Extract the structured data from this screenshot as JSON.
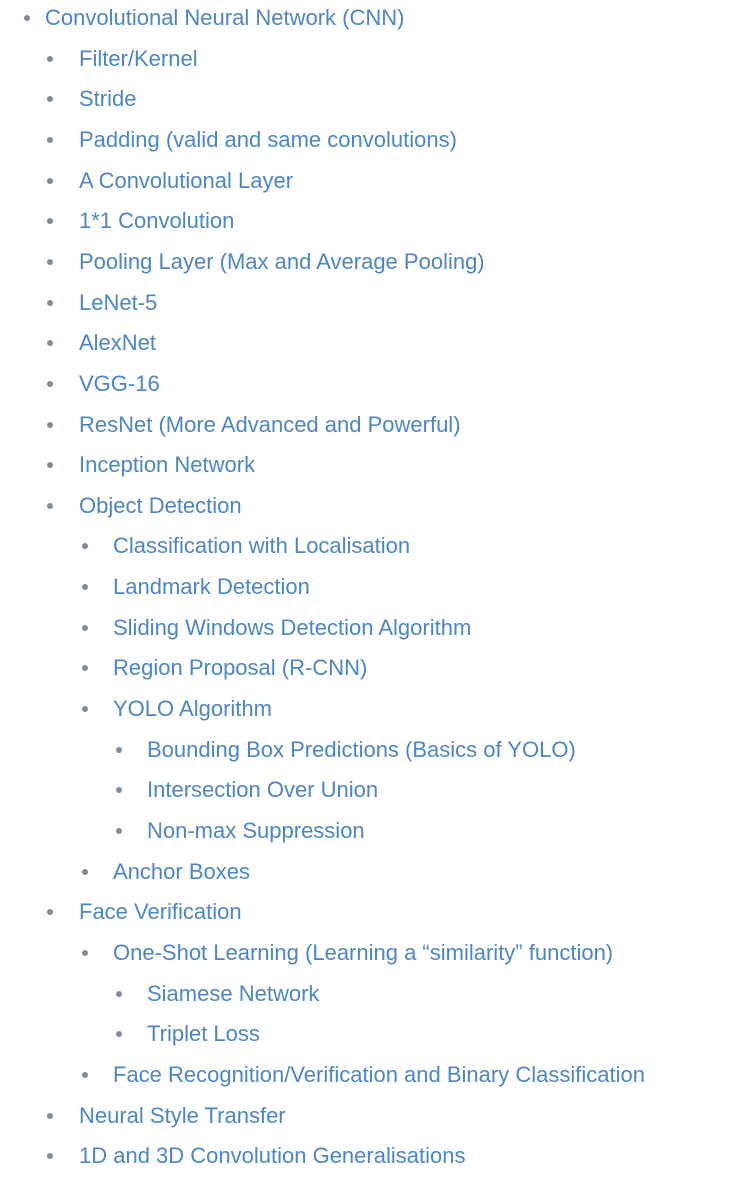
{
  "outline": [
    {
      "level": 0,
      "text": "Convolutional Neural Network (CNN)"
    },
    {
      "level": 1,
      "text": "Filter/Kernel"
    },
    {
      "level": 1,
      "text": "Stride"
    },
    {
      "level": 1,
      "text": "Padding (valid and same convolutions)"
    },
    {
      "level": 1,
      "text": "A Convolutional Layer"
    },
    {
      "level": 1,
      "text": "1*1 Convolution"
    },
    {
      "level": 1,
      "text": "Pooling Layer (Max and Average Pooling)"
    },
    {
      "level": 1,
      "text": "LeNet-5"
    },
    {
      "level": 1,
      "text": "AlexNet"
    },
    {
      "level": 1,
      "text": "VGG-16"
    },
    {
      "level": 1,
      "text": "ResNet (More Advanced and Powerful)"
    },
    {
      "level": 1,
      "text": "Inception Network"
    },
    {
      "level": 1,
      "text": "Object Detection"
    },
    {
      "level": 2,
      "text": "Classification with Localisation"
    },
    {
      "level": 2,
      "text": "Landmark Detection"
    },
    {
      "level": 2,
      "text": "Sliding Windows Detection Algorithm"
    },
    {
      "level": 2,
      "text": "Region Proposal (R-CNN)"
    },
    {
      "level": 2,
      "text": "YOLO Algorithm"
    },
    {
      "level": 3,
      "text": "Bounding Box Predictions (Basics of YOLO)"
    },
    {
      "level": 3,
      "text": "Intersection Over Union"
    },
    {
      "level": 3,
      "text": "Non-max Suppression"
    },
    {
      "level": 2,
      "text": "Anchor Boxes"
    },
    {
      "level": 1,
      "text": "Face Verification"
    },
    {
      "level": 2,
      "text": "One-Shot Learning (Learning a “similarity” function)"
    },
    {
      "level": 3,
      "text": "Siamese Network"
    },
    {
      "level": 3,
      "text": "Triplet Loss"
    },
    {
      "level": 2,
      "text": "Face Recognition/Verification and Binary Classification"
    },
    {
      "level": 1,
      "text": "Neural Style Transfer"
    },
    {
      "level": 1,
      "text": "1D and 3D Convolution Generalisations"
    }
  ]
}
